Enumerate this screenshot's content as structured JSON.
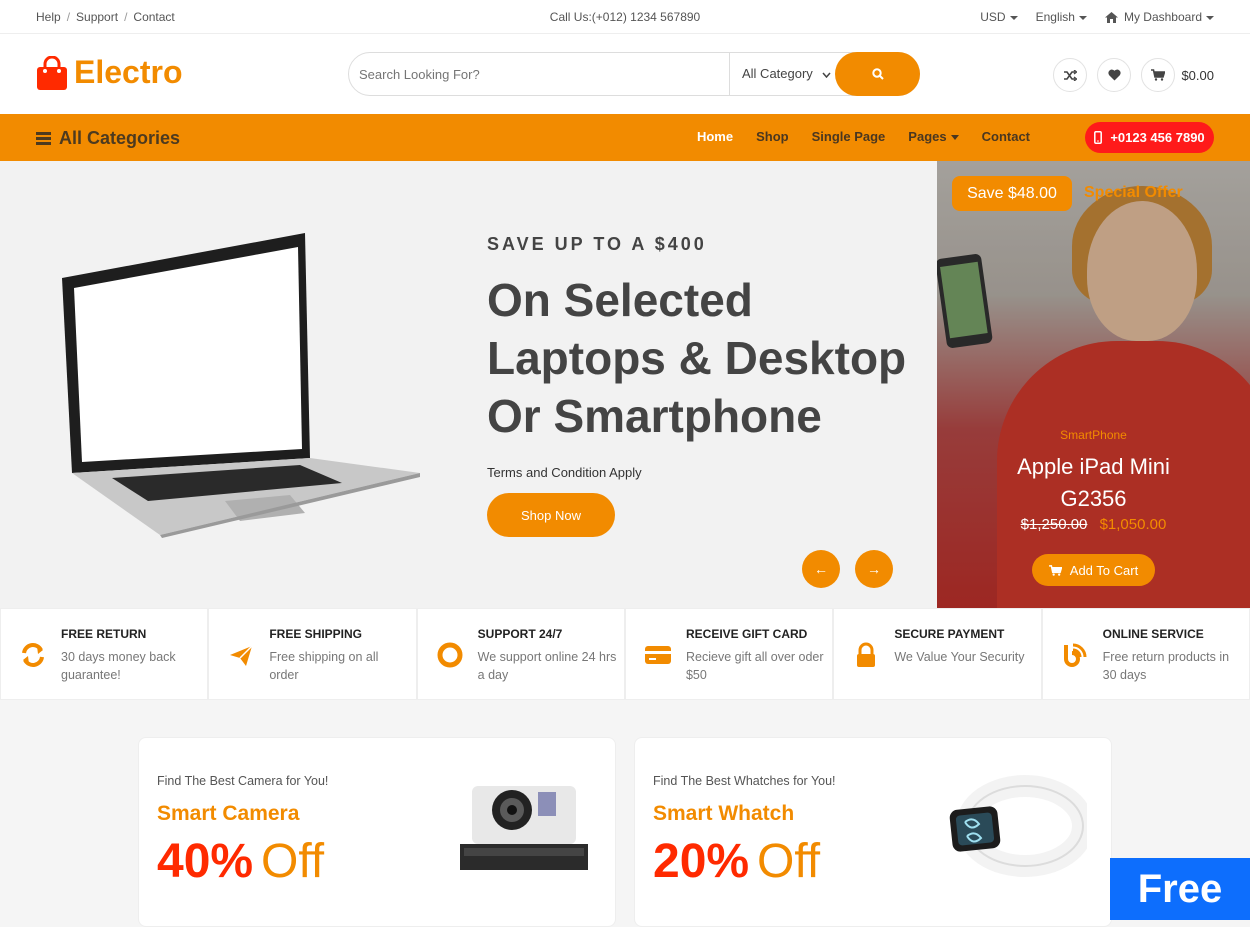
{
  "topbar": {
    "links": [
      "Help",
      "Support",
      "Contact"
    ],
    "separator": "/",
    "call": "Call Us:(+012) 1234 567890",
    "currency": "USD",
    "language": "English",
    "dashboard": "My Dashboard"
  },
  "header": {
    "brand": "Electro",
    "search_placeholder": "Search Looking For?",
    "category": "All Category",
    "cart_total": "$0.00"
  },
  "nav": {
    "all_categories": "All Categories",
    "links": [
      "Home",
      "Shop",
      "Single Page",
      "Pages",
      "Contact"
    ],
    "phone": "+0123 456 7890"
  },
  "hero": {
    "kicker": "SAVE UP TO A $400",
    "title_lines": [
      "On Selected",
      "Laptops & Desktop",
      "Or Smartphone"
    ],
    "terms": "Terms and Condition Apply",
    "cta": "Shop Now",
    "prev": "←",
    "next": "→"
  },
  "promo": {
    "save": "Save $48.00",
    "special": "Special Offer",
    "category": "SmartPhone",
    "name": "Apple iPad Mini G2356",
    "old_price": "$1,250.00",
    "new_price": "$1,050.00",
    "cta": "Add To Cart"
  },
  "features": [
    {
      "title": "FREE RETURN",
      "desc": "30 days money back guarantee!",
      "icon": "refresh-icon"
    },
    {
      "title": "FREE SHIPPING",
      "desc": "Free shipping on all order",
      "icon": "paper-plane-icon"
    },
    {
      "title": "SUPPORT 24/7",
      "desc": "We support online 24 hrs a day",
      "icon": "life-ring-icon"
    },
    {
      "title": "RECEIVE GIFT CARD",
      "desc": "Recieve gift all over oder $50",
      "icon": "credit-card-icon"
    },
    {
      "title": "SECURE PAYMENT",
      "desc": "We Value Your Security",
      "icon": "lock-icon"
    },
    {
      "title": "ONLINE SERVICE",
      "desc": "Free return products in 30 days",
      "icon": "blog-icon"
    }
  ],
  "cards": [
    {
      "small": "Find The Best Camera for You!",
      "name": "Smart Camera",
      "pct": "40%",
      "off": "Off"
    },
    {
      "small": "Find The Best Whatches for You!",
      "name": "Smart Whatch",
      "pct": "20%",
      "off": "Off"
    }
  ],
  "badge": "Free",
  "colors": {
    "accent": "#f28b00",
    "red": "#ff1a1a",
    "blue": "#0d6efd"
  }
}
